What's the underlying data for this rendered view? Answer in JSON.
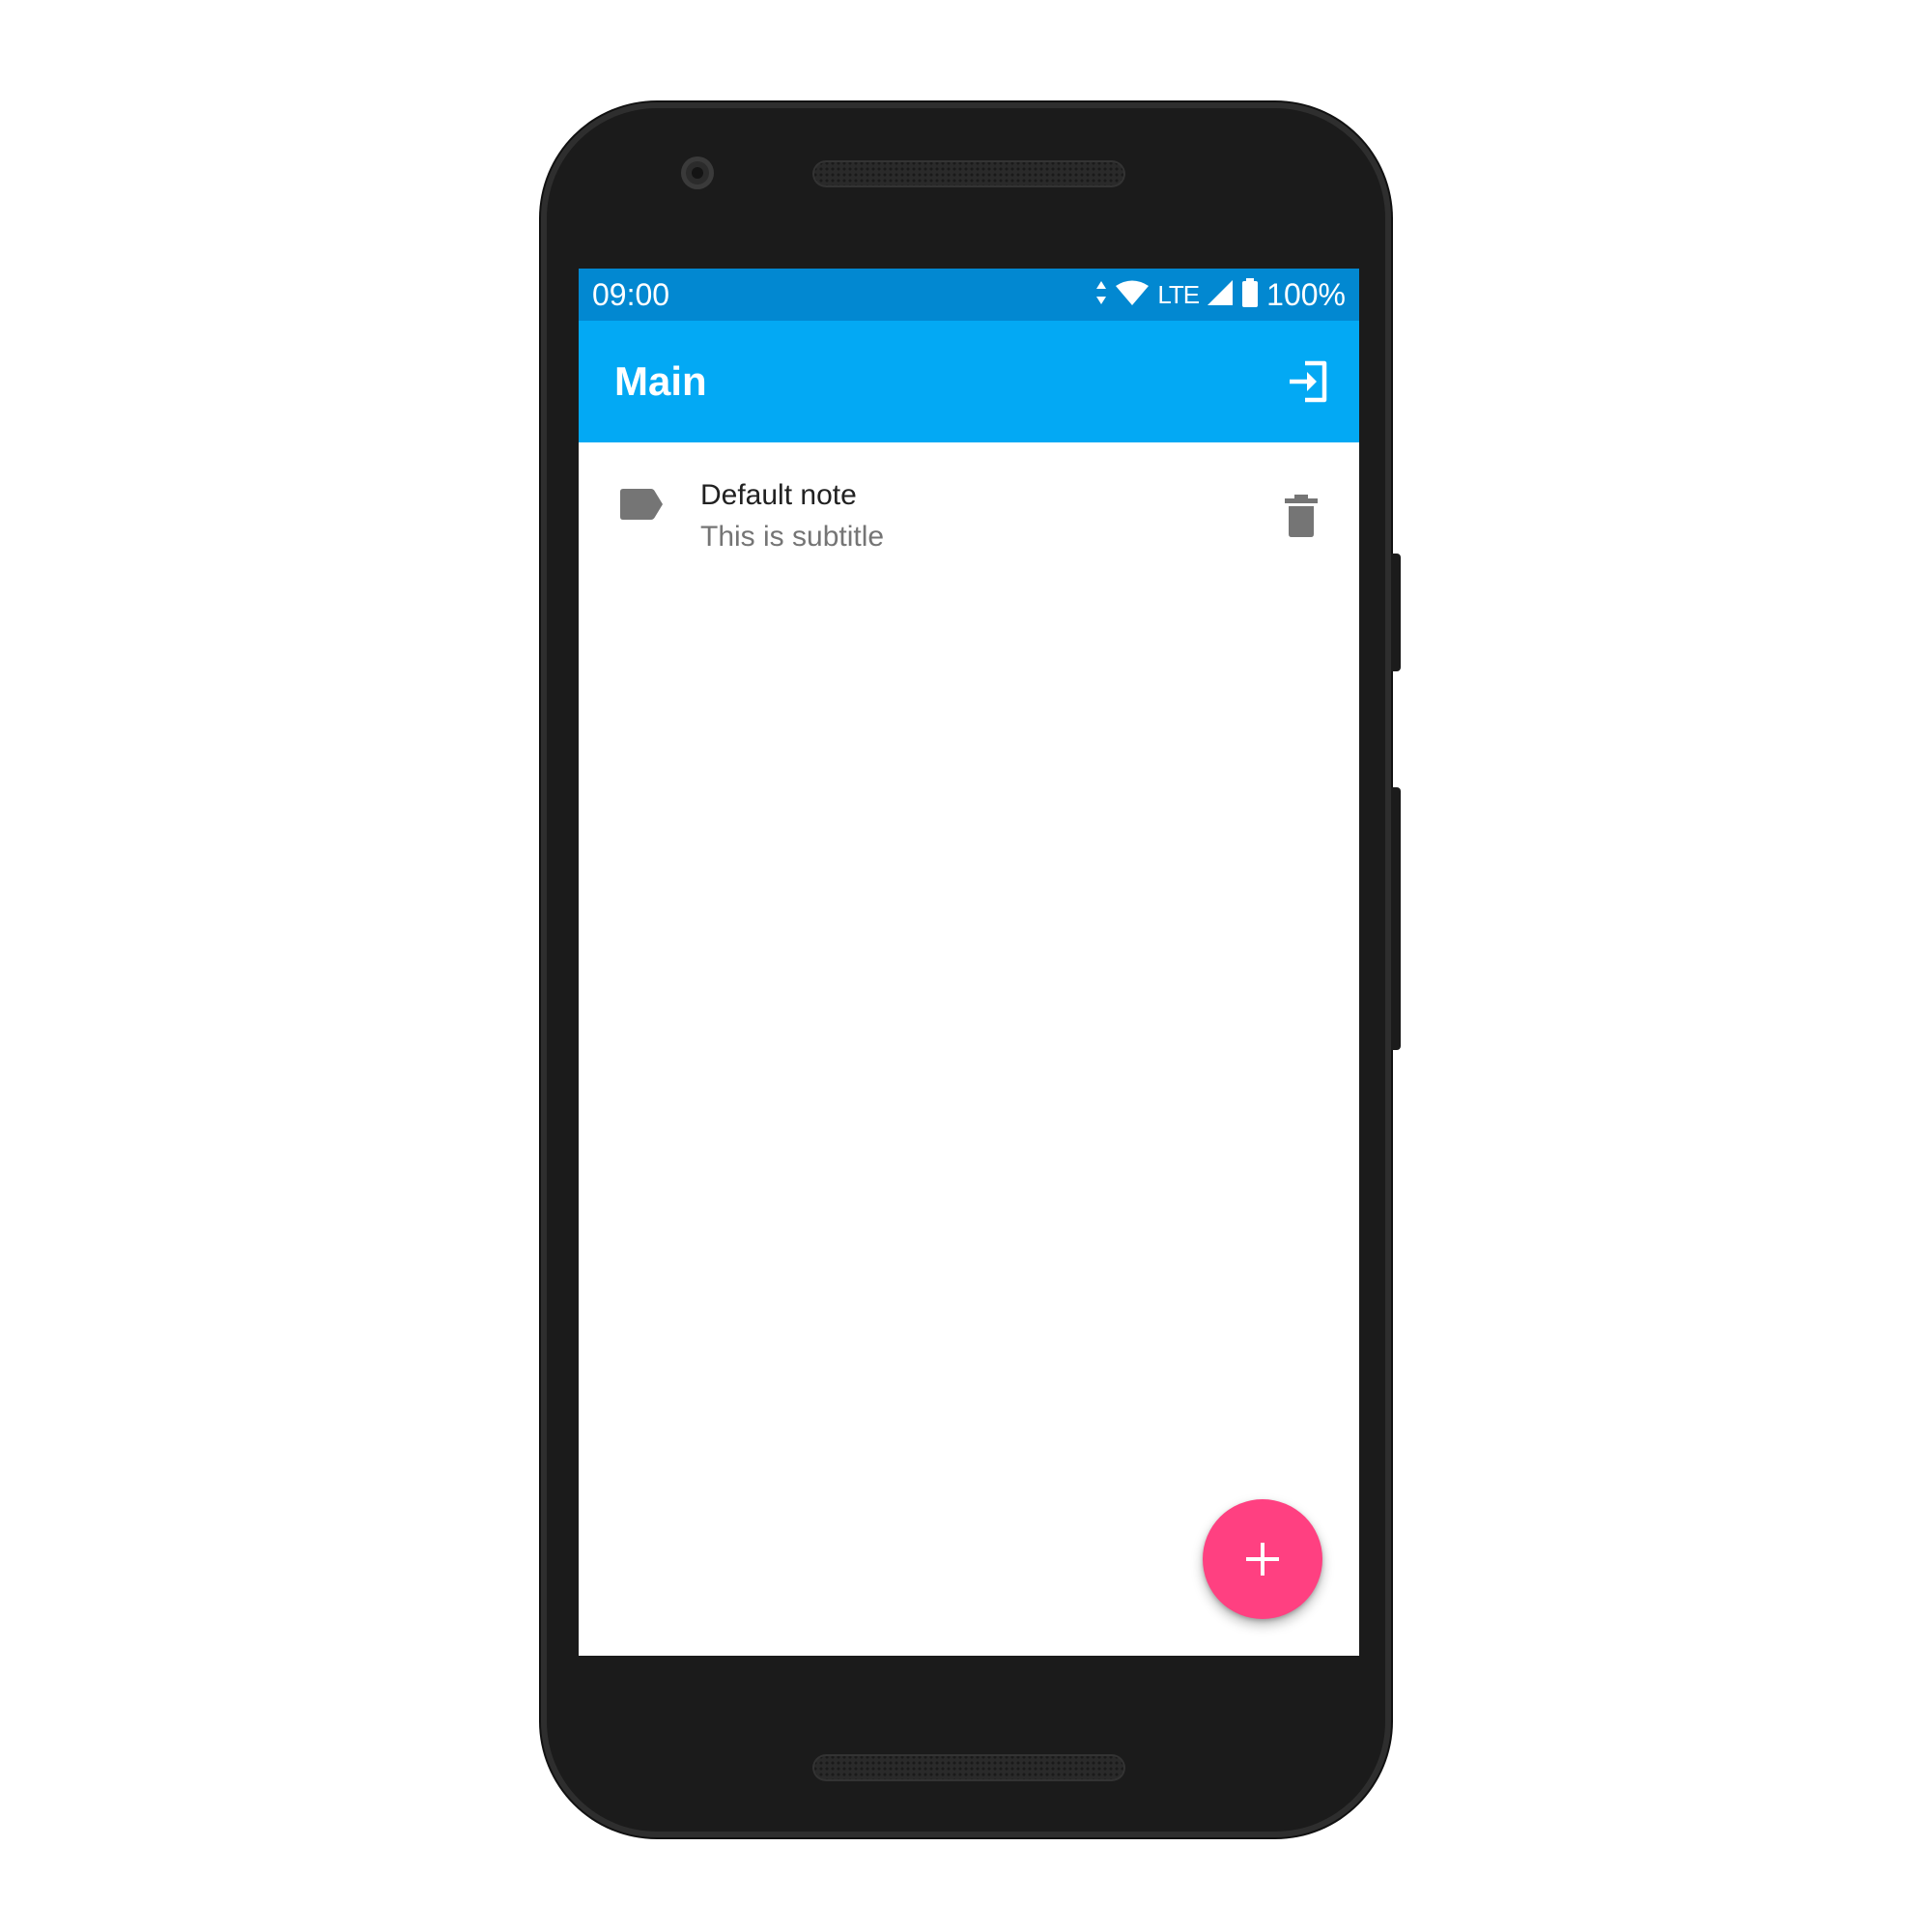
{
  "status_bar": {
    "time": "09:00",
    "network": "LTE",
    "battery": "100%",
    "icons": [
      "data-arrows-icon",
      "wifi-icon",
      "cell-signal-icon",
      "battery-icon"
    ]
  },
  "app_bar": {
    "title": "Main",
    "action_icon": "login-icon"
  },
  "notes": [
    {
      "icon": "label-icon",
      "title": "Default note",
      "subtitle": "This is subtitle",
      "action_icon": "delete-icon"
    }
  ],
  "fab": {
    "icon": "add-icon"
  },
  "colors": {
    "status_bar": "#0288d1",
    "app_bar": "#03a9f4",
    "fab": "#ff4081",
    "icon_gray": "#757575",
    "title_text": "#212121",
    "subtitle_text": "#757575"
  }
}
